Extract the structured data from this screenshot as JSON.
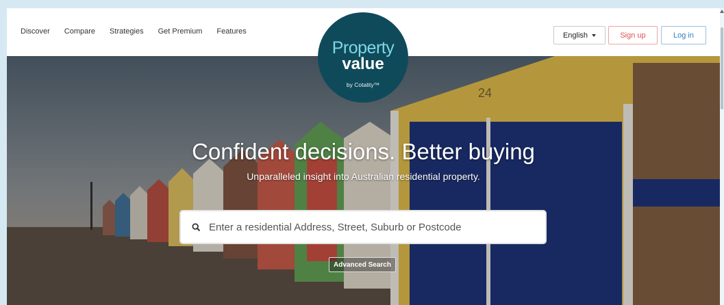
{
  "nav": {
    "items": [
      {
        "label": "Discover"
      },
      {
        "label": "Compare"
      },
      {
        "label": "Strategies"
      },
      {
        "label": "Get Premium"
      },
      {
        "label": "Features"
      }
    ]
  },
  "header": {
    "language_label": "English",
    "signup_label": "Sign up",
    "login_label": "Log in"
  },
  "logo": {
    "line1": "Property",
    "line2": "value",
    "line3": "by Cotality™"
  },
  "hero": {
    "headline": "Confident decisions. Better buying",
    "subheadline": "Unparalleled insight into Australian residential property.",
    "hut_number": "24"
  },
  "search": {
    "placeholder": "Enter a residential Address, Street, Suburb or Postcode",
    "icon": "search-icon"
  },
  "advanced_search_label": "Advanced Search",
  "colors": {
    "logo_bg": "#0f4a5a",
    "signup": "#e05050",
    "login": "#2f7fc1"
  }
}
